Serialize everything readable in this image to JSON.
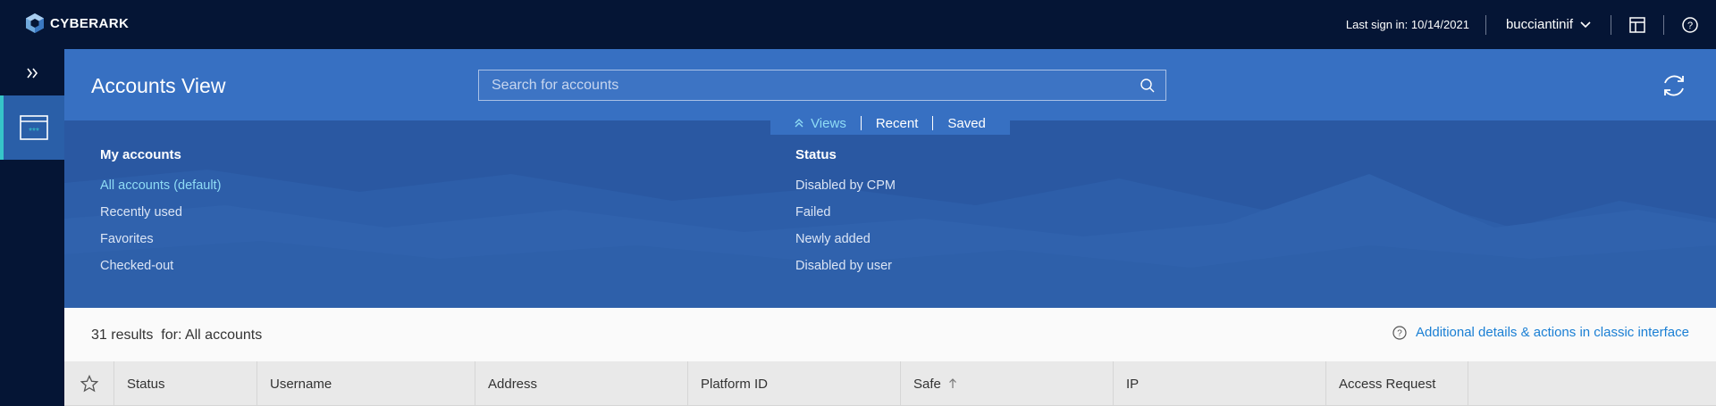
{
  "brand": {
    "name": "CYBERARK"
  },
  "topbar": {
    "last_sign_in": "Last sign in: 10/14/2021",
    "username": "bucciantinif"
  },
  "icons": {
    "expand": "double-chevron-right-icon",
    "accounts": "password-card-icon",
    "user_menu": "chevron-down-icon",
    "layout": "layout-icon",
    "help": "help-circle-icon",
    "search": "search-icon",
    "refresh": "refresh-icon",
    "views_collapse": "double-chevron-up-icon",
    "classic_help": "help-circle-icon",
    "favorite": "star-icon",
    "sort": "sort-ascending-icon"
  },
  "header": {
    "title": "Accounts View",
    "search_placeholder": "Search for accounts"
  },
  "tabs": [
    {
      "label": "Views",
      "active": true
    },
    {
      "label": "Recent",
      "active": false
    },
    {
      "label": "Saved",
      "active": false
    }
  ],
  "views": {
    "my_accounts": {
      "title": "My accounts",
      "items": [
        "All accounts (default)",
        "Recently used",
        "Favorites",
        "Checked-out"
      ]
    },
    "status": {
      "title": "Status",
      "items": [
        "Disabled by CPM",
        "Failed",
        "Newly added",
        "Disabled by user"
      ]
    }
  },
  "results": {
    "count": "31 results",
    "filter": "for: All accounts",
    "classic_link": "Additional details & actions in classic interface"
  },
  "table": {
    "columns": [
      "Status",
      "Username",
      "Address",
      "Platform ID",
      "Safe",
      "IP",
      "Access Request"
    ]
  },
  "colors": {
    "topbar": "#051535",
    "header": "#3770c2",
    "panel": "#2a58a2",
    "accent": "#36c5c9",
    "link": "#1a7fd4",
    "active_link": "#8fdcf5"
  }
}
